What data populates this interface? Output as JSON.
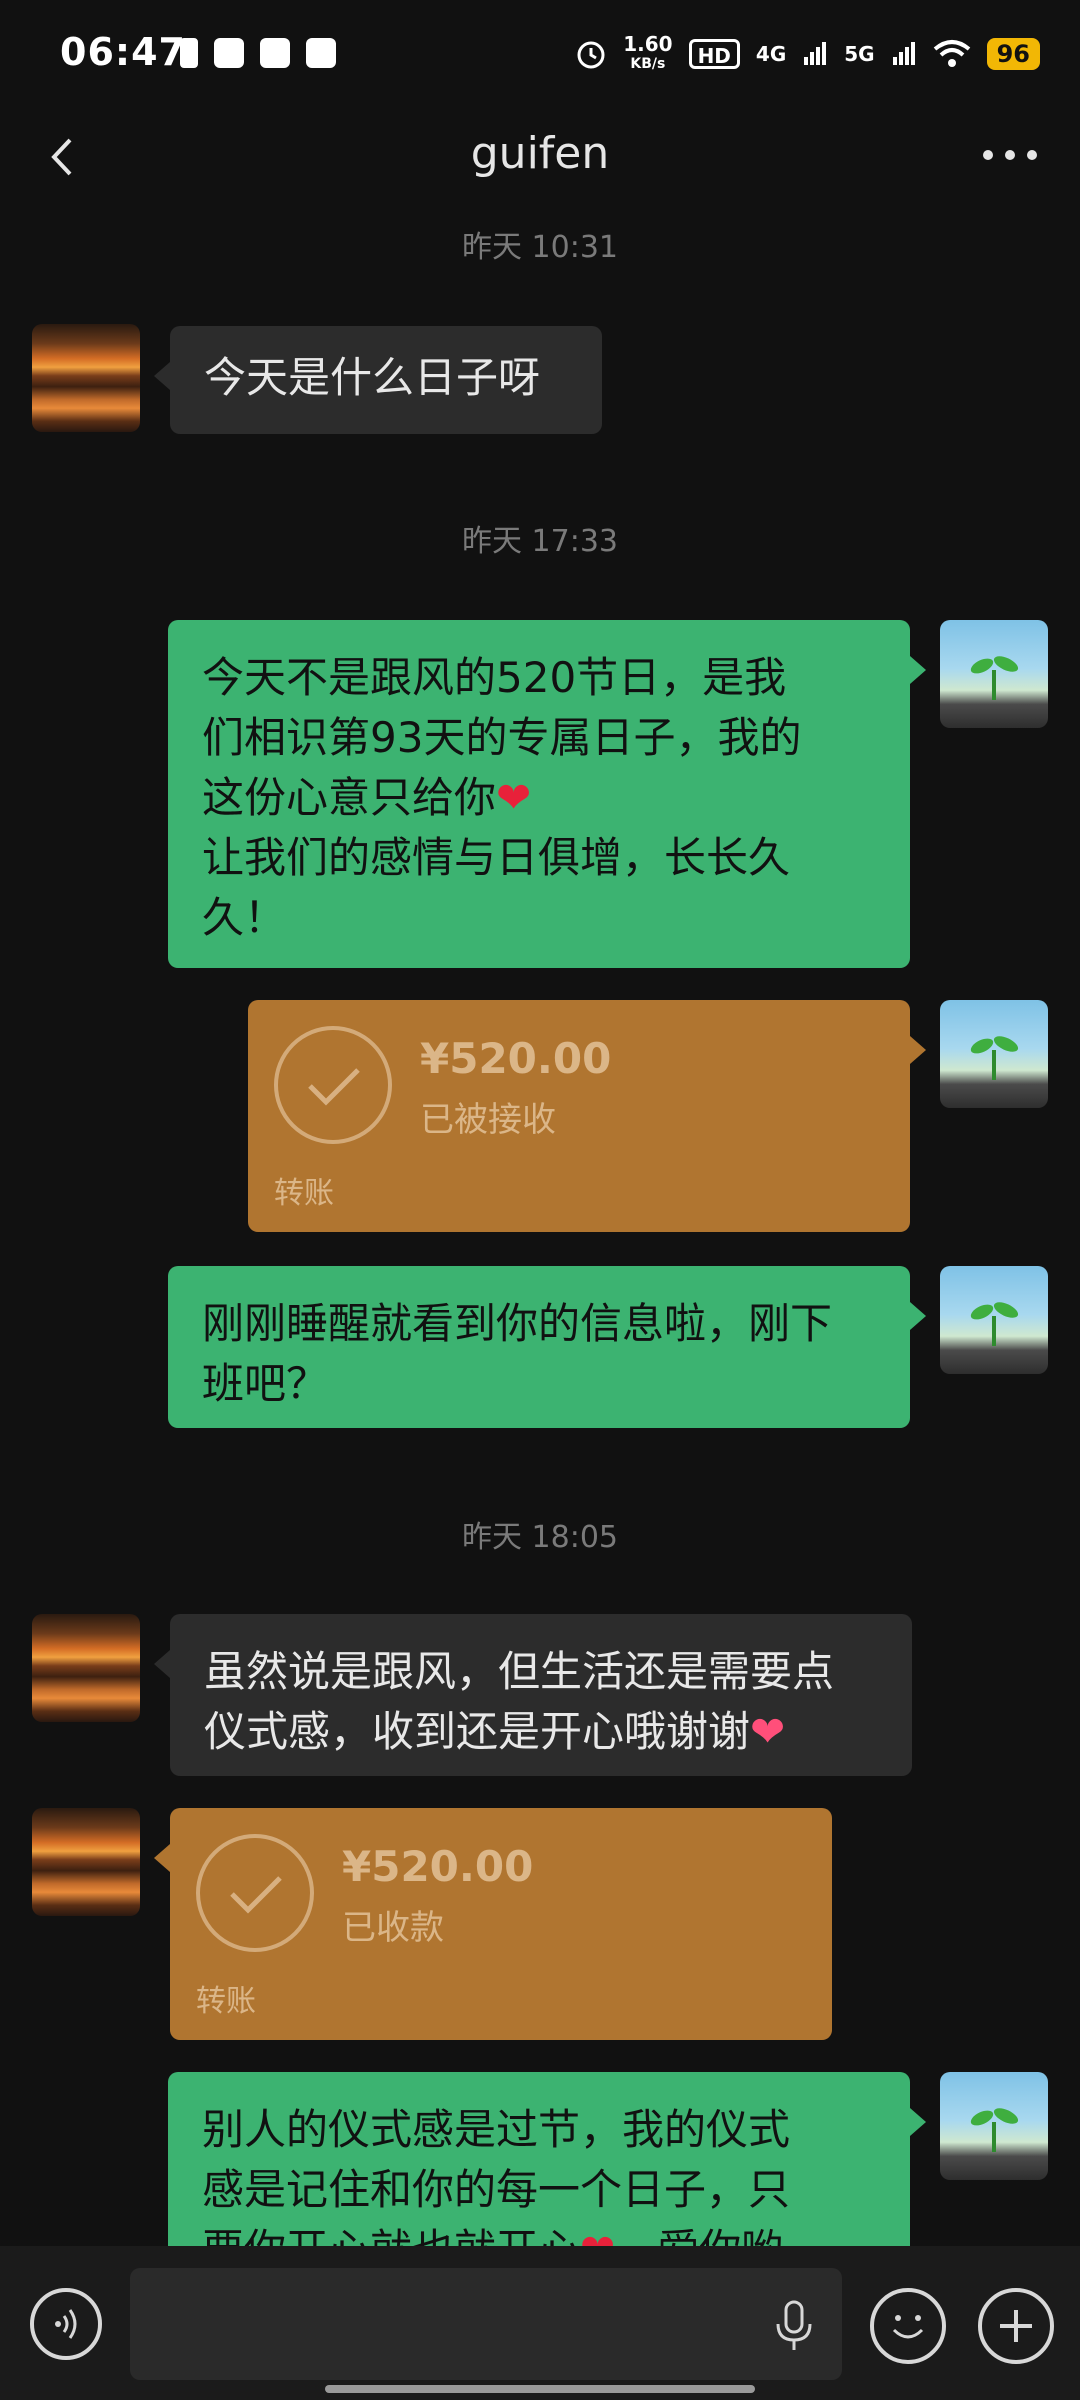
{
  "status_bar": {
    "time": "06:47",
    "net_speed_top": "1.60",
    "net_speed_bottom": "KB/s",
    "hd": "HD",
    "signal_1": "4G",
    "signal_2": "5G",
    "battery": "96"
  },
  "header": {
    "title": "guifen"
  },
  "timestamps": {
    "t1": "昨天 10:31",
    "t2": "昨天 17:33",
    "t3": "昨天 18:05"
  },
  "messages": {
    "m1": "今天是什么日子呀",
    "m2_line1": "今天不是跟风的520节日，是我",
    "m2_line2": "们相识第93天的专属日子，我的",
    "m2_line3": "这份心意只给你",
    "m2_line4": "让我们的感情与日俱增，长长久",
    "m2_line5": "久！",
    "m3_line1": "刚刚睡醒就看到你的信息啦，刚下",
    "m3_line2": "班吧？",
    "m4_line1": "虽然说是跟风，但生活还是需要点",
    "m4_line2": "仪式感，收到还是开心哦谢谢",
    "m5_line1": "别人的仪式感是过节，我的仪式",
    "m5_line2": "感是记住和你的每一个日子，只",
    "m5_line3": "要你开心就也就开心",
    "m5_line3_tail": "，爱你哟"
  },
  "transfers": {
    "out": {
      "amount": "¥520.00",
      "status": "已被接收",
      "label": "转账"
    },
    "in": {
      "amount": "¥520.00",
      "status": "已收款",
      "label": "转账"
    }
  },
  "colors": {
    "bubble_out": "#3cb371",
    "bubble_in": "#2c2c2c",
    "transfer": "#b07530",
    "background": "#111111"
  },
  "icons": [
    "back-icon",
    "more-icon",
    "voice-icon",
    "mic-icon",
    "emoji-icon",
    "plus-icon",
    "heart-icon"
  ]
}
